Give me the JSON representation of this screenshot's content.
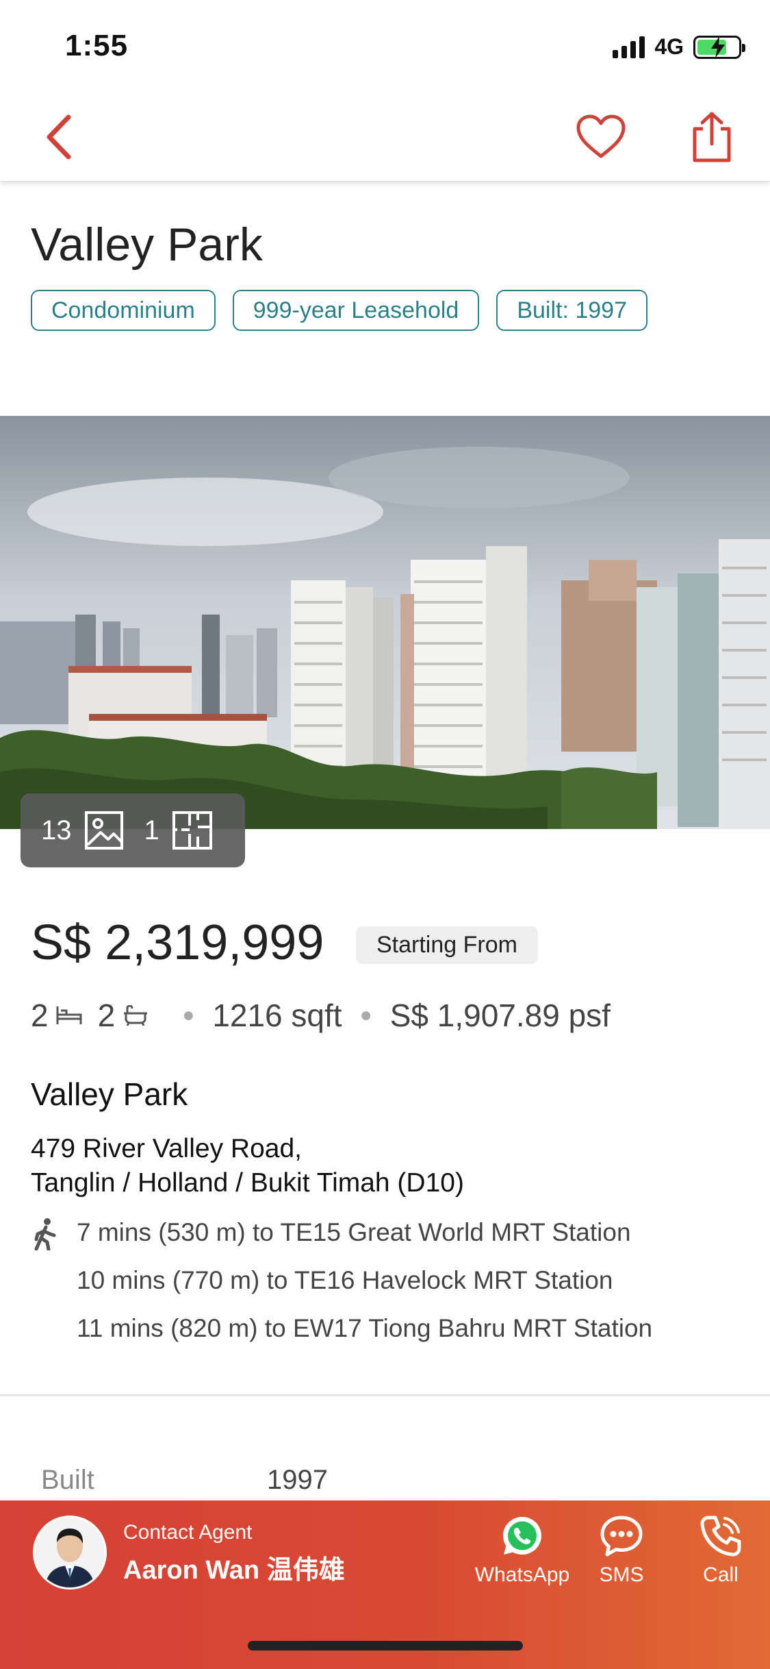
{
  "status_bar": {
    "time": "1:55",
    "network": "4G"
  },
  "nav": {
    "back_icon": "chevron-left-icon",
    "favorite_icon": "heart-icon",
    "share_icon": "share-icon",
    "accent_color": "#d0413a"
  },
  "listing": {
    "title": "Valley Park",
    "tags": [
      "Condominium",
      "999-year Leasehold",
      "Built: 1997"
    ],
    "media": {
      "photo_count": "13",
      "floorplan_count": "1"
    },
    "price": "S$ 2,319,999",
    "price_badge": "Starting From",
    "bedrooms": "2",
    "bathrooms": "2",
    "area": "1216 sqft",
    "psf": "S$ 1,907.89 psf",
    "project_name": "Valley Park",
    "address_line1": "479 River Valley Road,",
    "address_line2": "Tanglin / Holland / Bukit Timah (D10)",
    "mrt": [
      "7 mins (530 m) to TE15 Great World MRT Station",
      "10 mins (770 m) to TE16 Havelock MRT Station",
      "11 mins (820 m) to EW17 Tiong Bahru MRT Station"
    ],
    "details": {
      "built_label": "Built",
      "built_value": "1997"
    }
  },
  "contact": {
    "label": "Contact Agent",
    "agent_name": "Aaron Wan 温伟雄",
    "actions": [
      "WhatsApp",
      "SMS",
      "Call"
    ]
  },
  "colors": {
    "tag_teal": "#2b8088",
    "contact_bar": "#d64036"
  }
}
